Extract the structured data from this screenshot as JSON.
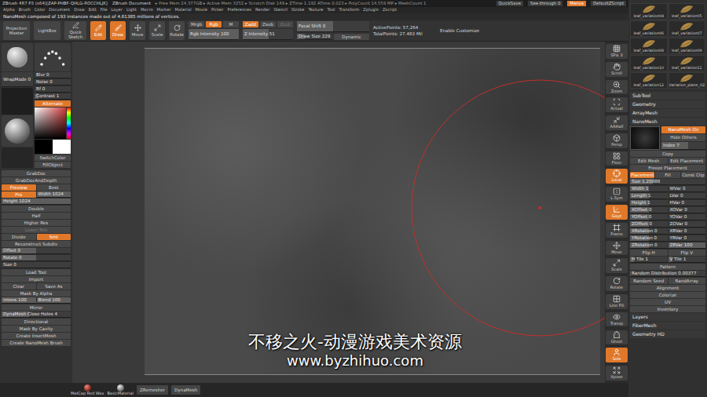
{
  "title_bar": {
    "app": "ZBrush 4R7 P3 (x64)[ZAP-PHBF-QHLG-ROCCHLJK]",
    "document": "ZBrush Document",
    "stats": "▸ Free Mem 24.377GB ▸ Active Mem 3252 ▸ Scratch Disk 149 ▸ ZTime 1.192 ATime 0.023 ▸ PolyCount 14.559 MP ▸ MeshCount 1",
    "buttons": [
      {
        "label": "QuickSave",
        "selected": false
      },
      {
        "label": "See-through 0",
        "selected": false
      },
      {
        "label": "Menus",
        "selected": true
      },
      {
        "label": "DefaultZScript",
        "selected": false
      }
    ]
  },
  "menu": [
    "Alpha",
    "Brush",
    "Color",
    "Document",
    "Draw",
    "Edit",
    "File",
    "Layer",
    "Light",
    "Macro",
    "Marker",
    "Material",
    "Movie",
    "Picker",
    "Preferences",
    "Render",
    "Stencil",
    "Stroke",
    "Texture",
    "Tool",
    "Transform",
    "Zplugin",
    "Zscript"
  ],
  "notice": "NanoMesh composed of 193 instances made out of 4.61385 millions of vertices.",
  "toolbar": {
    "nav": [
      "Projection Master",
      "LightBox"
    ],
    "quick_sketch": "Quick Sketch",
    "modes": [
      {
        "label": "Edit",
        "selected": true
      },
      {
        "label": "Draw",
        "selected": true
      },
      {
        "label": "Move",
        "selected": false
      },
      {
        "label": "Scale",
        "selected": false
      },
      {
        "label": "Rotate",
        "selected": false
      }
    ],
    "rgb_buttons": [
      {
        "label": "Mrgb",
        "selected": false,
        "disabled": false
      },
      {
        "label": "Rgb",
        "selected": true,
        "disabled": false
      },
      {
        "label": "M",
        "selected": false,
        "disabled": false
      }
    ],
    "rgb_intensity": {
      "label": "Rgb Intensity 100",
      "level": 1
    },
    "z_buttons": [
      {
        "label": "Zadd",
        "selected": true,
        "disabled": false
      },
      {
        "label": "Zsub",
        "selected": false,
        "disabled": false
      },
      {
        "label": "Zcut",
        "selected": false,
        "disabled": true
      }
    ],
    "z_intensity": {
      "label": "Z Intensity 51",
      "level": 0.51
    },
    "focal_shift": {
      "label": "Focal Shift 0",
      "level": 0.5
    },
    "draw_size": {
      "label": "Draw Size 229",
      "level": 0.23
    },
    "dynamic": {
      "label": "Dynamic",
      "selected": false
    },
    "stats": [
      "ActivePoints: 57,264",
      "TotalPoints: 27.483 Mil"
    ],
    "customize": "Enable Customize"
  },
  "left_panel": {
    "wrap_mode": {
      "label": "WrapMode 0",
      "level": 0
    },
    "sliders": [
      {
        "label": "Blur 0",
        "level": 0
      },
      {
        "label": "Noise 0",
        "level": 0
      },
      {
        "label": "Rf 0",
        "level": 0
      },
      {
        "label": "Contrast 1",
        "level": 0.1
      }
    ],
    "alternate": {
      "label": "Alternate",
      "selected": true
    },
    "color_buttons": [
      "SwitchColor",
      "FillObject"
    ],
    "rows": [
      [
        {
          "kind": "button",
          "label": "GrabDoc",
          "selected": false,
          "disabled": false
        }
      ],
      [
        {
          "kind": "button",
          "label": "GrabDocAndDepth",
          "selected": false,
          "disabled": false
        }
      ],
      [
        {
          "kind": "button",
          "label": "Preview",
          "selected": true,
          "disabled": false
        },
        {
          "kind": "button",
          "label": "Best",
          "selected": false,
          "disabled": false
        }
      ],
      [
        {
          "kind": "button",
          "label": "Pro",
          "selected": true,
          "disabled": false
        },
        {
          "kind": "slider",
          "label": "Width 1024",
          "level": 1
        }
      ],
      [
        {
          "kind": "slider",
          "label": "Height 1024",
          "level": 1
        }
      ],
      [
        {
          "kind": "button",
          "label": "Double",
          "selected": false,
          "disabled": false
        }
      ],
      [
        {
          "kind": "button",
          "label": "Half",
          "selected": false,
          "disabled": false
        }
      ],
      [
        {
          "kind": "button",
          "label": "Higher Res",
          "selected": false,
          "disabled": false
        }
      ],
      [
        {
          "kind": "button",
          "label": "Lower Res",
          "selected": false,
          "disabled": true
        }
      ],
      [
        {
          "kind": "button",
          "label": "Divide",
          "selected": false,
          "disabled": false
        },
        {
          "kind": "button",
          "label": "Smt",
          "selected": true,
          "disabled": false
        }
      ],
      [
        {
          "kind": "button",
          "label": "Reconstruct Subdiv",
          "selected": false,
          "disabled": false
        }
      ],
      [
        {
          "kind": "slider",
          "label": "Offset 0",
          "level": 0.5
        }
      ],
      [
        {
          "kind": "slider",
          "label": "Rotate 0",
          "level": 0.5
        }
      ],
      [
        {
          "kind": "slider",
          "label": "Size 0",
          "level": 0
        }
      ],
      [
        {
          "kind": "button",
          "label": "Load Tool",
          "selected": false,
          "disabled": false
        }
      ],
      [
        {
          "kind": "button",
          "label": "Import",
          "selected": false,
          "disabled": false
        }
      ],
      [
        {
          "kind": "button",
          "label": "Clear",
          "selected": false,
          "disabled": false
        },
        {
          "kind": "button",
          "label": "Save As",
          "selected": false,
          "disabled": false
        }
      ],
      [
        {
          "kind": "button",
          "label": "Mask By Alpha",
          "selected": false,
          "disabled": false
        }
      ],
      [
        {
          "kind": "slider",
          "label": "Intens 100",
          "level": 1
        },
        {
          "kind": "slider",
          "label": "Blend 100",
          "level": 1
        }
      ],
      [
        {
          "kind": "button",
          "label": "Mirror",
          "selected": false,
          "disabled": false
        }
      ],
      [
        {
          "kind": "slider",
          "label": "DynaMesh Close Holes 4",
          "level": 0.4
        }
      ],
      [
        {
          "kind": "button",
          "label": "Directional",
          "selected": false,
          "disabled": false
        }
      ],
      [
        {
          "kind": "button",
          "label": "Mask By Cavity",
          "selected": false,
          "disabled": false
        }
      ],
      [
        {
          "kind": "button",
          "label": "Create InsertMesh",
          "selected": false,
          "disabled": false
        }
      ],
      [
        {
          "kind": "button",
          "label": "Create NanoMesh Brush",
          "selected": false,
          "disabled": false
        }
      ]
    ]
  },
  "watermark": [
    "不移之火-动漫游戏美术资源",
    "www.byzhihuo.com"
  ],
  "shelf": [
    {
      "label": "SPix 3",
      "selected": false
    },
    {
      "label": "Scroll",
      "selected": false
    },
    {
      "label": "Zoom",
      "selected": false
    },
    {
      "label": "Actual",
      "selected": false
    },
    {
      "label": "AAHalf",
      "selected": false
    },
    {
      "label": "Persp",
      "selected": false
    },
    {
      "label": "Floor",
      "selected": false
    },
    {
      "label": "Local",
      "selected": true
    },
    {
      "label": "L.Sym",
      "selected": false
    },
    {
      "label": "Gxyz",
      "selected": true
    },
    {
      "label": "Frame",
      "selected": false
    },
    {
      "label": "Move",
      "selected": false
    },
    {
      "label": "Scale",
      "selected": false
    },
    {
      "label": "Rotate",
      "selected": false
    },
    {
      "label": "Line Fill",
      "selected": false
    },
    {
      "label": "Transp",
      "selected": false
    },
    {
      "label": "Ghost",
      "selected": false
    },
    {
      "label": "Solo",
      "selected": true
    },
    {
      "label": "Xpose",
      "selected": false
    }
  ],
  "bottom_bar": {
    "materials": [
      "MatCap Red Wax",
      "BasicMaterial"
    ],
    "buttons": [
      "ZRemesher",
      "DynaMesh"
    ]
  },
  "right_panel": {
    "tools": [
      "leaf_variation04",
      "leaf_variation05",
      "leaf_variation06",
      "leaf_variation07",
      "leaf_variation08",
      "leaf_variation09",
      "leaf_variation10",
      "leaf_variation11",
      "leaf_variation12",
      "Variation_plane_02"
    ],
    "sections": [
      "SubTool",
      "Geometry",
      "ArrayMesh"
    ],
    "nanomesh": {
      "title": "NanoMesh",
      "side": [
        {
          "kind": "button",
          "label": "NanoMesh On",
          "selected": true,
          "disabled": false
        },
        {
          "kind": "button",
          "label": "Hide Others",
          "selected": false,
          "disabled": false
        },
        {
          "kind": "slider",
          "label": "Index 7",
          "level": 0.6
        }
      ],
      "rows": [
        [
          {
            "kind": "button",
            "label": "Copy",
            "selected": false,
            "disabled": false
          }
        ],
        [
          {
            "kind": "button",
            "label": "Edit Mesh",
            "selected": false,
            "disabled": false
          },
          {
            "kind": "button",
            "label": "Edit Placement",
            "selected": false,
            "disabled": false
          }
        ],
        [
          {
            "kind": "button",
            "label": "Freeze Placement",
            "selected": false,
            "disabled": false
          }
        ],
        [
          {
            "kind": "button",
            "label": "Placement",
            "selected": true,
            "disabled": false
          },
          {
            "kind": "button",
            "label": "Fill",
            "selected": false,
            "disabled": false
          },
          {
            "kind": "button",
            "label": "Const Clip",
            "selected": false,
            "disabled": false
          }
        ],
        [
          {
            "kind": "slider",
            "label": "Size 1.20888",
            "level": 0.3
          }
        ],
        [
          {
            "kind": "slider",
            "label": "Width 1",
            "level": 0.5
          },
          {
            "kind": "slider",
            "label": "WVar 0",
            "level": 0
          }
        ],
        [
          {
            "kind": "slider",
            "label": "Length 1",
            "level": 0.5
          },
          {
            "kind": "slider",
            "label": "LVar 0",
            "level": 0
          }
        ],
        [
          {
            "kind": "slider",
            "label": "Height 1",
            "level": 0.5
          },
          {
            "kind": "slider",
            "label": "HVar 0",
            "level": 0
          }
        ],
        [
          {
            "kind": "slider",
            "label": "XOffset 0",
            "level": 0.5
          },
          {
            "kind": "slider",
            "label": "XOVar 0",
            "level": 0
          }
        ],
        [
          {
            "kind": "slider",
            "label": "YOffset 0",
            "level": 0.5
          },
          {
            "kind": "slider",
            "label": "YOVar 0",
            "level": 0
          }
        ],
        [
          {
            "kind": "slider",
            "label": "ZOffset 0",
            "level": 0.5
          },
          {
            "kind": "slider",
            "label": "ZOVar 0",
            "level": 0
          }
        ],
        [
          {
            "kind": "slider",
            "label": "XRotation 0",
            "level": 0.5
          },
          {
            "kind": "slider",
            "label": "XRVar 0",
            "level": 0
          }
        ],
        [
          {
            "kind": "slider",
            "label": "YRotation 0",
            "level": 0.5
          },
          {
            "kind": "slider",
            "label": "YRVar 0",
            "level": 0
          }
        ],
        [
          {
            "kind": "slider",
            "label": "ZRotation 0",
            "level": 0.5
          },
          {
            "kind": "slider",
            "label": "ZRVar 100",
            "level": 1
          }
        ],
        [
          {
            "kind": "button",
            "label": "Flip H",
            "selected": false,
            "disabled": false
          },
          {
            "kind": "button",
            "label": "Flip V",
            "selected": false,
            "disabled": false
          }
        ],
        [
          {
            "kind": "slider",
            "label": "H Tile 1",
            "level": 0.1
          },
          {
            "kind": "slider",
            "label": "V Tile 1",
            "level": 0.1
          }
        ],
        [
          {
            "kind": "button",
            "label": "Pattern",
            "selected": false,
            "disabled": false
          }
        ],
        [
          {
            "kind": "slider",
            "label": "Random Distribution 0.00377",
            "level": 0.01
          }
        ],
        [
          {
            "kind": "button",
            "label": "Random Seed",
            "selected": false,
            "disabled": false
          },
          {
            "kind": "button",
            "label": "RandArray",
            "selected": false,
            "disabled": false
          }
        ],
        [
          {
            "kind": "button",
            "label": "Alignment",
            "selected": false,
            "disabled": false
          }
        ],
        [
          {
            "kind": "button",
            "label": "Colorize",
            "selected": false,
            "disabled": false
          }
        ],
        [
          {
            "kind": "button",
            "label": "UV",
            "selected": false,
            "disabled": false
          }
        ],
        [
          {
            "kind": "button",
            "label": "Inventory",
            "selected": false,
            "disabled": false
          }
        ]
      ]
    },
    "footer_sections": [
      "Layers",
      "FiberMesh",
      "Geometry HD"
    ]
  }
}
